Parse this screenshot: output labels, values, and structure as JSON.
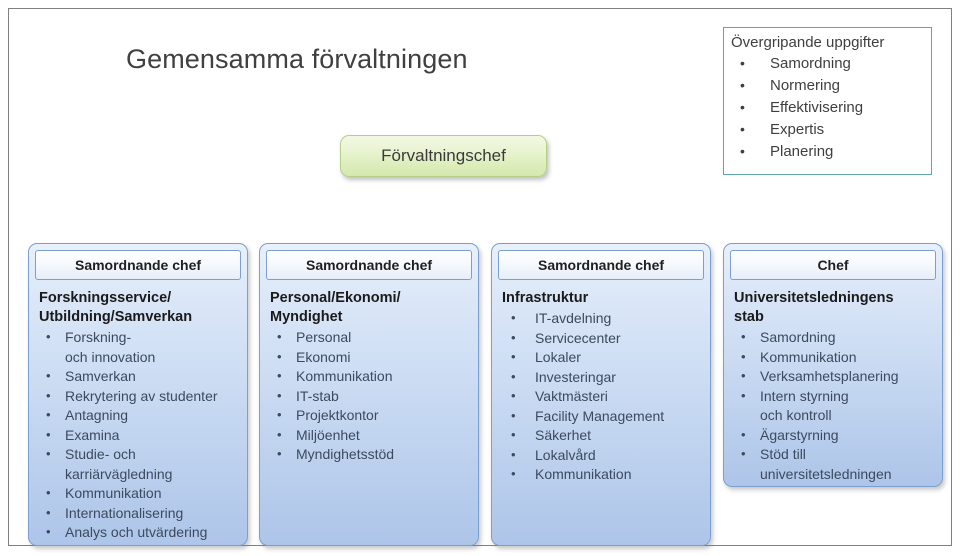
{
  "page": {
    "title": "Gemensamma förvaltningen"
  },
  "chief": {
    "label": "Förvaltningschef"
  },
  "overall_tasks": {
    "title": "Övergripande uppgifter",
    "items": [
      "Samordning",
      "Normering",
      "Effektivisering",
      "Expertis",
      "Planering"
    ]
  },
  "columns": [
    {
      "header": "Samordnande chef",
      "title_line1": "Forskningsservice/",
      "title_line2": "Utbildning/Samverkan",
      "items": [
        {
          "line1": "Forskning-",
          "line2": "och innovation"
        },
        {
          "line1": "Samverkan"
        },
        {
          "line1": "Rekrytering av studenter"
        },
        {
          "line1": "Antagning"
        },
        {
          "line1": "Examina"
        },
        {
          "line1": "Studie- och",
          "line2": "karriärvägledning"
        },
        {
          "line1": "Kommunikation"
        },
        {
          "line1": "Internationalisering"
        },
        {
          "line1": "Analys och utvärdering"
        }
      ]
    },
    {
      "header": "Samordnande chef",
      "title_line1": "Personal/Ekonomi/",
      "title_line2": "Myndighet",
      "items": [
        {
          "line1": "Personal"
        },
        {
          "line1": "Ekonomi"
        },
        {
          "line1": "Kommunikation"
        },
        {
          "line1": "IT-stab"
        },
        {
          "line1": "Projektkontor"
        },
        {
          "line1": "Miljöenhet"
        },
        {
          "line1": "Myndighetsstöd"
        }
      ]
    },
    {
      "header": "Samordnande chef",
      "title_line1": "Infrastruktur",
      "title_line2": "",
      "items": [
        {
          "line1": "IT-avdelning"
        },
        {
          "line1": "Servicecenter"
        },
        {
          "line1": "Lokaler"
        },
        {
          "line1": "Investeringar"
        },
        {
          "line1": "Vaktmästeri"
        },
        {
          "line1": "Facility Management"
        },
        {
          "line1": "Säkerhet"
        },
        {
          "line1": "Lokalvård"
        },
        {
          "line1": "Kommunikation"
        }
      ]
    },
    {
      "header": "Chef",
      "title_line1": "Universitetsledningens",
      "title_line2": "stab",
      "items": [
        {
          "line1": "Samordning"
        },
        {
          "line1": "Kommunikation"
        },
        {
          "line1": "Verksamhetsplanering"
        },
        {
          "line1": "Intern styrning",
          "line2": "och kontroll"
        },
        {
          "line1": "Ägarstyrning"
        },
        {
          "line1": "Stöd till",
          "line2": "universitetsledningen"
        }
      ]
    }
  ],
  "colors": {
    "frame_border": "#808080",
    "chief_fill_top": "#f2f8e4",
    "chief_fill_bottom": "#d4e8ae",
    "chief_border": "#b5cf88",
    "tasks_border": "#5fa5ad",
    "column_border": "#7a9fd0",
    "column_fill_top": "#e8f0fb",
    "column_fill_bottom": "#adc5e9",
    "title_text": "#404040",
    "body_text": "#3c4a5e"
  }
}
